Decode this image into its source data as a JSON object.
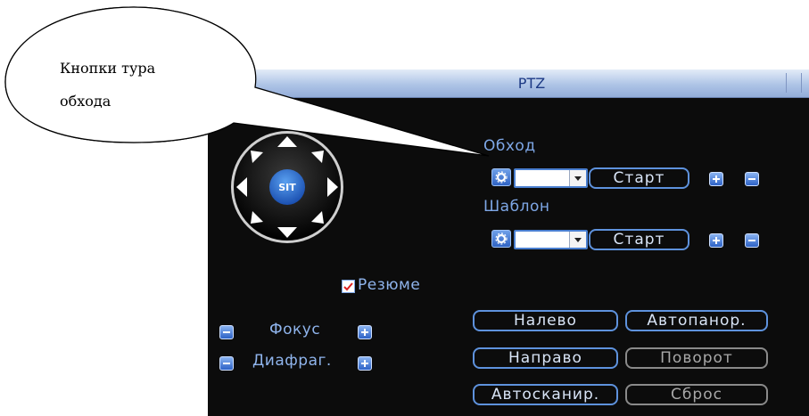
{
  "callout": {
    "line1": "Кнопки тура",
    "line2": "обхода"
  },
  "window": {
    "title": "PTZ"
  },
  "joystick": {
    "center_label": "SIT"
  },
  "tour": {
    "label": "Обход",
    "select_value": "",
    "start_label": "Старт"
  },
  "pattern": {
    "label": "Шаблон",
    "select_value": "",
    "start_label": "Старт"
  },
  "resume": {
    "label": "Резюме",
    "checked": true
  },
  "focus": {
    "label": "Фокус"
  },
  "iris": {
    "label": "Диафраг."
  },
  "buttons": {
    "left": "Налево",
    "autopan": "Автопанор.",
    "right": "Направо",
    "rotate": "Поворот",
    "autoscan": "Автосканир.",
    "reset": "Сброс"
  },
  "colors": {
    "panel": "#0c0c0c",
    "accent": "#5e92dd",
    "label": "#8fb4ec",
    "title": "#1d3a85"
  }
}
